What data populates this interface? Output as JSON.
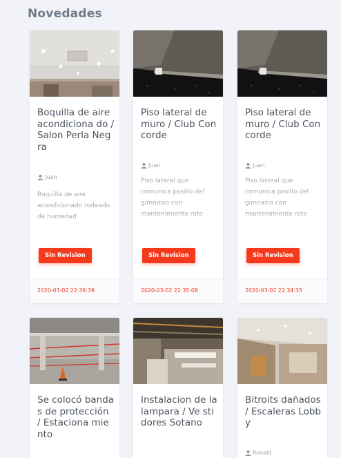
{
  "section": {
    "title": "Novedades"
  },
  "colors": {
    "accent": "#f5391c",
    "title_text": "#6f7c8c",
    "background": "#f2f3f8"
  },
  "cards": [
    {
      "title": "Boquilla de aire acondiciona do  / Salon Perla Negra",
      "author": "Juan",
      "description": "Boquilla de aire acondicionado rodeado de humedad",
      "status": "Sin Revision",
      "timestamp": "2020-03-02 22:36:39",
      "image": "ceiling-lights-photo"
    },
    {
      "title": "Piso lateral de muro  / Club Concorde",
      "author": "Juan",
      "description": "Piso lateral que comunica pasillo del gimnasio con mantenimiento roto",
      "status": "Sin Revision",
      "timestamp": "2020-03-02 22:35:08",
      "image": "floor-wall-photo"
    },
    {
      "title": "Piso lateral de muro  / Club Concorde",
      "author": "Juan",
      "description": "Piso lateral que comunica pasillo del gimnasio con mantenimiento roto",
      "status": "Sin Revision",
      "timestamp": "2020-03-02 22:34:35",
      "image": "floor-wall-photo"
    },
    {
      "title": "Se colocó bandas de protección  / Estaciona miento",
      "image": "parking-tape-photo"
    },
    {
      "title": "Instalacion de la lampara / Ve stidores Sotano",
      "image": "ceiling-install-photo"
    },
    {
      "title": "Bitroits dañados  / Escaleras Lobby",
      "author": "Ronald",
      "image": "lobby-stairs-photo"
    }
  ]
}
